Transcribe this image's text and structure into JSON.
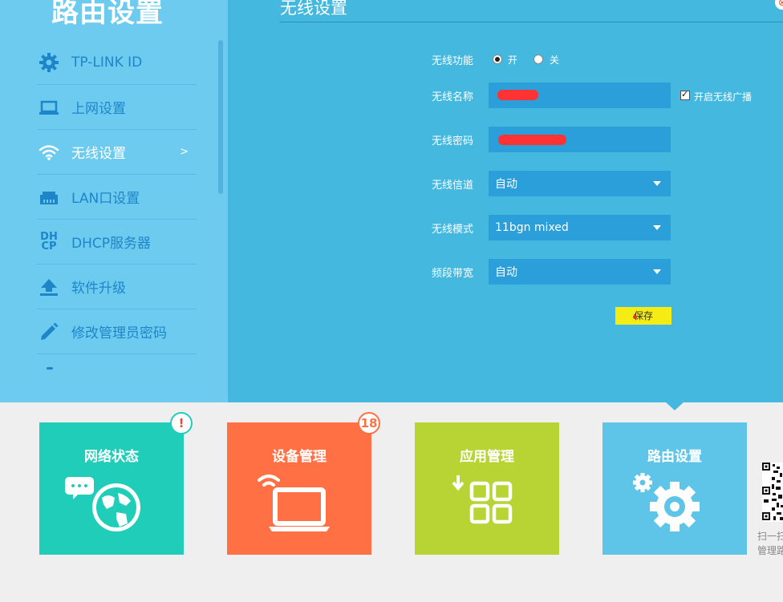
{
  "sidebar": {
    "title": "路由设置",
    "items": [
      {
        "label": "TP-LINK ID"
      },
      {
        "label": "上网设置"
      },
      {
        "label": "无线设置",
        "chevron": ">"
      },
      {
        "label": "LAN口设置"
      },
      {
        "label": "DHCP服务器",
        "icon_text_top": "DH",
        "icon_text_bottom": "CP"
      },
      {
        "label": "软件升级"
      },
      {
        "label": "修改管理员密码"
      }
    ]
  },
  "main": {
    "title": "无线设置",
    "close_glyph": "⊗",
    "wireless_function": {
      "label": "无线功能",
      "on_label": "开",
      "off_label": "关",
      "selected": "开"
    },
    "ssid": {
      "label": "无线名称",
      "value": ""
    },
    "broadcast": {
      "label": "开启无线广播",
      "checked": true
    },
    "password": {
      "label": "无线密码",
      "value": ""
    },
    "channel": {
      "label": "无线信道",
      "value": "自动"
    },
    "mode": {
      "label": "无线模式",
      "value": "11bgn mixed"
    },
    "bandwidth": {
      "label": "频段带宽",
      "value": "自动"
    },
    "save_label": "保存"
  },
  "tiles": [
    {
      "label": "网络状态",
      "color": "#1fcdb9",
      "badge": "!",
      "badge_color": "#e84a2c"
    },
    {
      "label": "设备管理",
      "color": "#ff7145",
      "badge": "18",
      "badge_color": "#ff7145"
    },
    {
      "label": "应用管理",
      "color": "#b7d334"
    },
    {
      "label": "路由设置",
      "color": "#5ec4e8"
    }
  ],
  "qr": {
    "line1": "扫一扫",
    "line2": "管理路由器"
  },
  "colors": {
    "sidebar_bg": "#6dcbef",
    "main_bg": "#45b8e0",
    "accent_text": "#1e86c8",
    "save_button": "#f5ec14"
  }
}
